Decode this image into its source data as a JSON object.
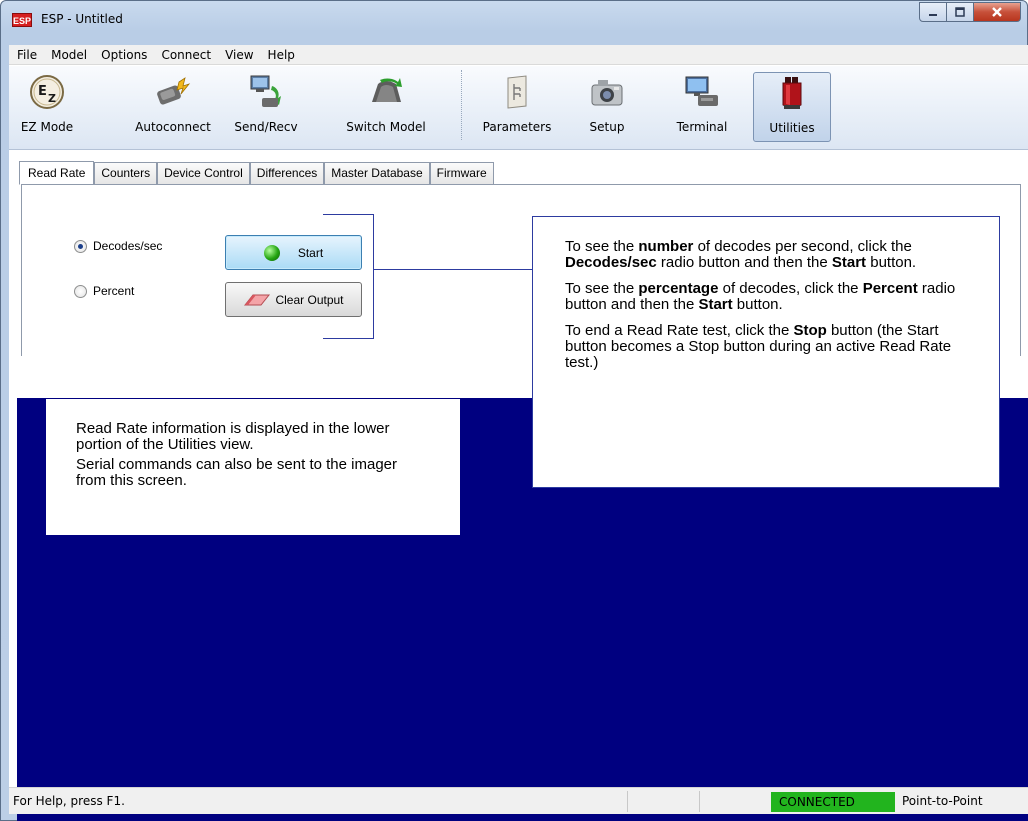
{
  "window": {
    "title": "ESP - Untitled",
    "app_icon_text": "ESP"
  },
  "menu": [
    "File",
    "Model",
    "Options",
    "Connect",
    "View",
    "Help"
  ],
  "toolbar": {
    "buttons": [
      {
        "label": "EZ Mode",
        "icon": "ez-mode-icon"
      },
      {
        "label": "Autoconnect",
        "icon": "autoconnect-icon"
      },
      {
        "label": "Send/Recv",
        "icon": "send-recv-icon"
      },
      {
        "label": "Switch Model",
        "icon": "switch-model-icon"
      },
      {
        "label": "Parameters",
        "icon": "parameters-icon"
      },
      {
        "label": "Setup",
        "icon": "camera-icon"
      },
      {
        "label": "Terminal",
        "icon": "terminal-icon"
      },
      {
        "label": "Utilities",
        "icon": "utilities-icon",
        "active": true
      }
    ]
  },
  "tabs": [
    "Read Rate",
    "Counters",
    "Device Control",
    "Differences",
    "Master Database",
    "Firmware"
  ],
  "read_rate": {
    "radio_decodes": "Decodes/sec",
    "radio_percent": "Percent",
    "selected": "Decodes/sec",
    "start_label": "Start",
    "clear_label": "Clear Output"
  },
  "callouts": {
    "left_p1": "Read Rate information is displayed in the lower portion of the Utilities view.",
    "left_p2": "Serial commands can also be sent to the imager from this screen.",
    "right_p1_a": "To see the ",
    "right_p1_b": "number",
    "right_p1_c": " of decodes per second, click the ",
    "right_p1_d": "Decodes/sec",
    "right_p1_e": " radio button and then the ",
    "right_p1_f": "Start",
    "right_p1_g": " button.",
    "right_p2_a": "To see the ",
    "right_p2_b": "percentage",
    "right_p2_c": " of decodes, click the ",
    "right_p2_d": "Percent",
    "right_p2_e": " radio button and then the ",
    "right_p2_f": "Start",
    "right_p2_g": " button.",
    "right_p3_a": "To end a Read Rate test, click the ",
    "right_p3_b": "Stop",
    "right_p3_c": " button (the Start button becomes a Stop button during an active Read Rate test.)"
  },
  "status": {
    "help_text": "For Help, press F1.",
    "connection": "CONNECTED",
    "mode": "Point-to-Point",
    "connection_color": "#22b41e",
    "output_background": "#000080"
  }
}
